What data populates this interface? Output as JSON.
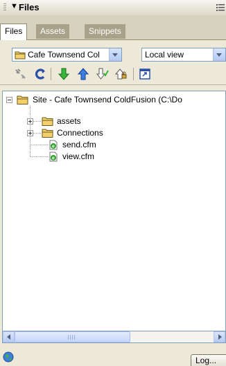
{
  "panel": {
    "title": "Files",
    "title_arrow": "▼",
    "options_icon": "options-list-icon"
  },
  "tabs": [
    {
      "label": "Files",
      "active": true
    },
    {
      "label": "Assets",
      "active": false
    },
    {
      "label": "Snippets",
      "active": false
    }
  ],
  "site_select": {
    "value": "Cafe Townsend Col",
    "icon": "folder-icon"
  },
  "view_select": {
    "value": "Local view"
  },
  "toolbar": {
    "buttons": [
      "connect-icon",
      "refresh-icon",
      "get-files-icon",
      "put-files-icon",
      "check-out-icon",
      "check-in-icon",
      "expand-panel-icon"
    ]
  },
  "tree": {
    "root": {
      "label": "Site - Cafe Townsend ColdFusion (C:\\Do",
      "expanded": true
    },
    "items": [
      {
        "label": "assets",
        "type": "folder",
        "expandable": true
      },
      {
        "label": "Connections",
        "type": "folder",
        "expandable": true
      },
      {
        "label": "send.cfm",
        "type": "file"
      },
      {
        "label": "view.cfm",
        "type": "file"
      }
    ]
  },
  "status": {
    "log_label": "Log..."
  },
  "colors": {
    "panel_bg": "#ece9d8",
    "tab_inactive": "#a7a289",
    "select_border": "#7f9db9",
    "folder_yellow": "#f3d06b",
    "arrow_green": "#2ea02e"
  }
}
